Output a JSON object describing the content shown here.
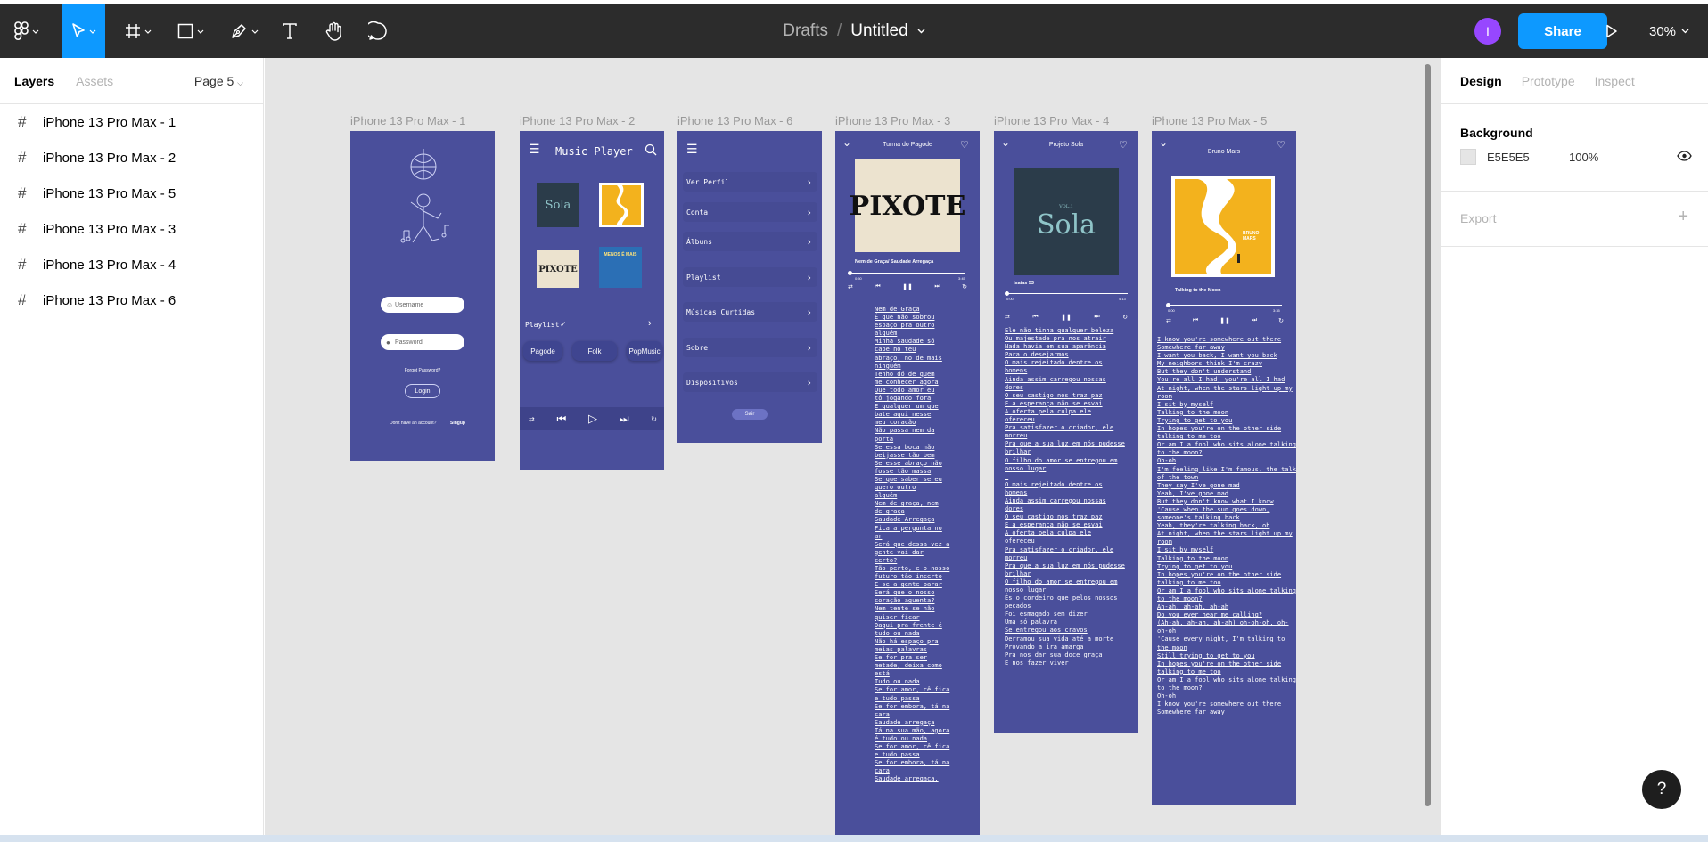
{
  "toolbar": {
    "crumb_parent": "Drafts",
    "crumb_sep": "/",
    "file_title": "Untitled",
    "avatar_initial": "I",
    "share_label": "Share",
    "zoom": "30%",
    "tools": [
      "figma-menu-icon",
      "move-icon",
      "frame-icon",
      "rectangle-icon",
      "pen-icon",
      "text-icon",
      "hand-icon",
      "comment-icon"
    ]
  },
  "left_panel": {
    "tabs": [
      "Layers",
      "Assets"
    ],
    "page": "Page 5",
    "layers": [
      "iPhone 13 Pro Max - 1",
      "iPhone 13 Pro Max - 2",
      "iPhone 13 Pro Max - 5",
      "iPhone 13 Pro Max - 3",
      "iPhone 13 Pro Max - 4",
      "iPhone 13 Pro Max - 6"
    ]
  },
  "frames": {
    "f1": {
      "label": "iPhone 13 Pro Max - 1",
      "username_placeholder": "Username",
      "password_placeholder": "Password",
      "forgot": "Forgot Password?",
      "login": "Login",
      "no_account": "Don't have an account?",
      "signup": "Singup"
    },
    "f2": {
      "label": "iPhone 13 Pro Max - 2",
      "title": "Music Player",
      "album1": "Sola",
      "album3": "PIXOTE",
      "album4": "MENOS É MAIS",
      "playlist": "Playlist",
      "chips": [
        "Pagode",
        "Folk",
        "PopMusic"
      ]
    },
    "f6": {
      "label": "iPhone 13 Pro Max - 6",
      "menu": [
        "Ver Perfil",
        "Conta",
        "Álbuns",
        "Playlist",
        "Músicas Curtidas",
        "Sobre",
        "Dispositivos"
      ],
      "exit": "Sair"
    },
    "f3": {
      "label": "iPhone 13 Pro Max - 3",
      "artist": "Turma do Pagode",
      "cover_text": "PIXOTE",
      "song": "Nem de Graça/ Saudade Arregaça",
      "time_start": "0:50",
      "time_end": "3:45",
      "lyrics": [
        "Nem de Graça",
        "É que não sobrou",
        "espaço pra outro",
        "alguém",
        "Minha saudade só",
        "cabe no teu",
        "abraço, no de mais",
        "ninguém",
        "Tenho dó de quem",
        "me conhecer agora",
        "Que todo amor eu",
        "tô jogando fora",
        "E qualquer um que",
        "bate aqui nesse",
        "meu coração",
        "Não passa nem da",
        "porta",
        "Se essa boca não",
        "beijasse tão bem",
        "Se esse abraço não",
        "fosse tão massa",
        "Se que saber se eu",
        "quero outro",
        "alguém",
        "Nem de graça, nem",
        "de graça",
        "Saudade Arregaça",
        "Fica a pergunta no",
        "ar",
        "Será que dessa vez a",
        "gente vai dar",
        "certo?",
        "Tão perto, e o nosso",
        "futuro tão incerto",
        "E se a gente parar",
        "Será que o nosso",
        "coração aguenta?",
        "Nem tente se não",
        "quiser ficar",
        "Daqui pra frente é",
        "tudo ou nada",
        "Não há espaço pra",
        "meias palavras",
        "Se for pra ser",
        "metade, deixa como",
        "está",
        "Tudo ou nada",
        "Se for amor, cê fica",
        "e tudo passa",
        "Se for embora, tá na",
        "cara",
        "Saudade arregaça",
        "Tá na sua mão, agora",
        "é tudo ou nada",
        "Se for amor, cê fica",
        "e tudo passa",
        "Se for embora, tá na",
        "cara",
        "Saudade arregaça."
      ]
    },
    "f4": {
      "label": "iPhone 13 Pro Max - 4",
      "artist": "Projeto Sola",
      "cover_text": "Sola",
      "cover_small": "VOL.1",
      "song": "Isaías 53",
      "time_start": "0:00",
      "time_end": "4:13",
      "lyrics": [
        "Ele não tinha qualquer beleza",
        "Ou majestade pra nos atrair",
        "Nada havia em sua aparência",
        "Para o desejarmos",
        "O mais rejeitado dentre os",
        "homens",
        "Ainda assim carregou nossas",
        "dores",
        "O seu castigo nos traz paz",
        "E a esperança não se esvai",
        "A oferta pela culpa ele",
        "ofereceu",
        "Pra satisfazer o criador, ele",
        "morreu",
        "Pra que a sua luz em nós pudesse",
        "brilhar",
        "O filho do amor se entregou em",
        "nosso lugar",
        "",
        "O mais rejeitado dentre os",
        "homens",
        "Ainda assim carregou nossas",
        "dores",
        "O seu castigo nos traz paz",
        "E a esperança não se esvai",
        "A oferta pela culpa ele",
        "ofereceu",
        "Pra satisfazer o criador, ele",
        "morreu",
        "Pra que a sua luz em nós pudesse",
        "brilhar",
        "O filho do amor se entregou em",
        "nosso lugar",
        "És o cordeiro que pelos nossos",
        "pecados",
        "Foi esmagado sem dizer",
        "Uma só palavra",
        "Se entregou aos cravos",
        "Derramou sua vida até a morte",
        "Provando a ira amarga",
        "Pra nos dar sua doce graça",
        "E nos fazer viver"
      ]
    },
    "f5": {
      "label": "iPhone 13 Pro Max - 5",
      "artist": "Bruno Mars",
      "cover_text": "BRUNO MARS",
      "song": "Talking to the Moon",
      "time_start": "0:00",
      "time_end": "3:35",
      "lyrics": [
        "I know you're somewhere out there",
        "Somewhere far away",
        "I want you back, I want you back",
        "My neighbors think I'm crazy",
        "But they don't understand",
        "You're all I had, you're all I had",
        "At night, when the stars light up my",
        "room",
        "I sit by myself",
        "Talking to the moon",
        "Trying to get to you",
        "In hopes you're on the other side",
        "talking to me too",
        "Or am I a fool who sits alone talking",
        "to the moon?",
        "Oh-oh",
        "I'm feeling like I'm famous, the talk",
        "of the town",
        "They say I've gone mad",
        "Yeah, I've gone mad",
        "But they don't know what I know",
        "'Cause when the sun goes down,",
        "someone's talking back",
        "Yeah, they're talking back, oh",
        "At night, when the stars light up my",
        "room",
        "I sit by myself",
        "Talking to the moon",
        "Trying to get to you",
        "In hopes you're on the other side",
        "talking to me too",
        "Or am I a fool who sits alone talking",
        "to the moon?",
        "Ah-ah, ah-ah, ah-ah",
        "Do you ever hear me calling?",
        "(Ah-ah, ah-ah, ah-ah) oh-oh-oh, oh-",
        "oh-oh",
        "'Cause every night, I'm talking to",
        "the moon",
        "Still trying to get to you",
        "In hopes you're on the other side",
        "talking to me too",
        "Or am I a fool who sits alone talking",
        "to the moon?",
        "Oh-oh",
        "I know you're somewhere out there",
        "Somewhere far away"
      ]
    }
  },
  "right_panel": {
    "tabs": [
      "Design",
      "Prototype",
      "Inspect"
    ],
    "background_title": "Background",
    "bg_hex": "E5E5E5",
    "bg_opacity": "100%",
    "export_title": "Export",
    "help": "?"
  },
  "colors": {
    "toolbar": "#2c2c2c",
    "accent": "#0d99ff",
    "frame_bg": "#4a4f9b",
    "canvas_bg": "#e5e5e5",
    "avatar": "#9747ff"
  }
}
